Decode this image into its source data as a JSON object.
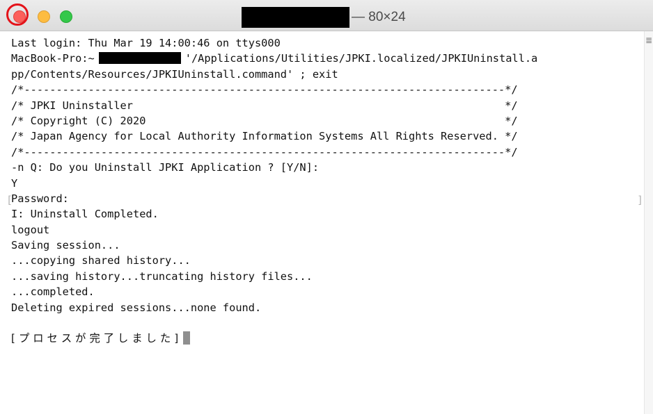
{
  "window": {
    "title_suffix": "— 80×24"
  },
  "terminal": {
    "lines": [
      "Last login: Thu Mar 19 14:00:46 on ttys000",
      "",
      "pp/Contents/Resources/JPKIUninstall.command' ; exit",
      "/*---------------------------------------------------------------------------*/",
      "/* JPKI Uninstaller                                                          */",
      "/* Copyright (C) 2020                                                        */",
      "/* Japan Agency for Local Authority Information Systems All Rights Reserved. */",
      "/*---------------------------------------------------------------------------*/",
      "-n Q: Do you Uninstall JPKI Application ? [Y/N]:",
      "Y",
      "Password:",
      "I: Uninstall Completed.",
      "logout",
      "Saving session...",
      "...copying shared history...",
      "...saving history...truncating history files...",
      "...completed.",
      "Deleting expired sessions...none found.",
      ""
    ],
    "prompt_host": "MacBook-Pro:~",
    "command_part": "'/Applications/Utilities/JPKI.localized/JPKIUninstall.a",
    "process_done": "[プロセスが完了しました]"
  }
}
